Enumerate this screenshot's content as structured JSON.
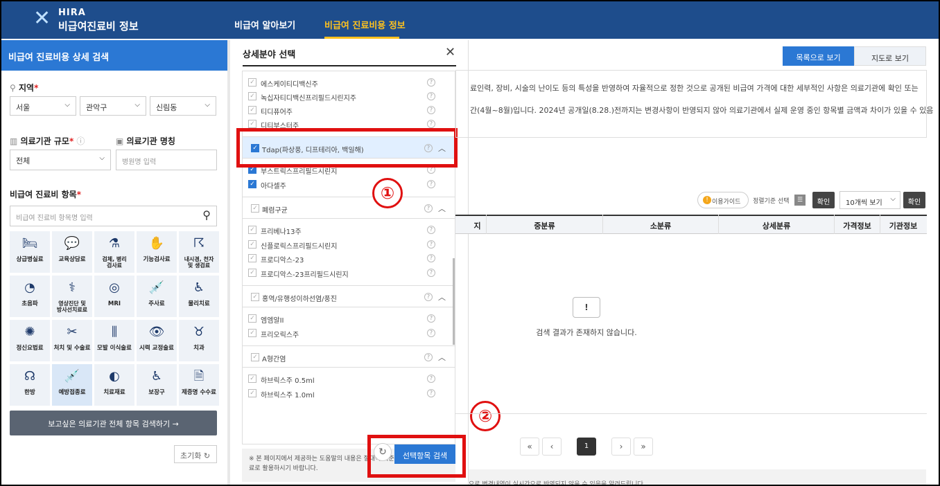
{
  "header": {
    "logo_line1": "HIRA",
    "logo_line2": "비급여진료비 정보",
    "nav": [
      "비급여 알아보기",
      "비급여 진료비용 정보"
    ],
    "accent": "#ffc21e",
    "bg": "#1e4d8c"
  },
  "left": {
    "title": "비급여 진료비용 상세 검색",
    "region_label": "지역",
    "region": [
      "서울",
      "관악구",
      "신림동"
    ],
    "scale_label": "의료기관 규모",
    "scale_value": "전체",
    "name_label": "의료기관 명칭",
    "name_placeholder": "병원명 입력",
    "items_label": "비급여 진료비 항목",
    "items_placeholder": "비급여 진료비 항목명 입력",
    "tiles": [
      "상급병실료",
      "교육상담료",
      "검체, 병리\n검사료",
      "기능검사료",
      "내시경, 천자\n및 생검료",
      "초음파",
      "영상진단 및\n방사선치료료",
      "MRI",
      "주사료",
      "물리치료",
      "정신요법료",
      "처치 및 수술료",
      "모발 이식술료",
      "시력 교정술료",
      "치과",
      "한방",
      "예방접종료",
      "치료재료",
      "보장구",
      "제증명 수수료"
    ],
    "search_all": "보고싶은 의료기관 전체 항목 검색하기 →",
    "reset": "초기화"
  },
  "modal": {
    "title": "상세분야 선택",
    "items_a": [
      "에스케이티디백신주",
      "녹십자티디백신프리필드시린지주",
      "티디퓨어주",
      "디티부스터주"
    ],
    "group_tdap": "Tdap(파상풍, 디프테리아, 백일해)",
    "items_b": [
      "부스트릭스프리필드시린지",
      "아다셀주"
    ],
    "group_pneumo": "폐렴구균",
    "items_c": [
      "프리베나13주",
      "신플로릭스프리필드시린지",
      "프로디악스-23",
      "프로디악스-23프리필드시린지"
    ],
    "group_mmr": "홍역/유행성이하선염/풍진",
    "items_d": [
      "엠엠알II",
      "프리오릭스주"
    ],
    "group_hepa": "A형간염",
    "items_e": [
      "하브릭스주 0.5ml",
      "하브릭스주 1.0ml"
    ],
    "note": "※ 본 페이지에서 제공하는 도움말의 내용은 절대적 기준이 아니오니 참고자료로 활용하시기 바랍니다.",
    "search_btn": "선택항목 검색",
    "marker1": "①",
    "marker2": "②"
  },
  "main": {
    "tab_list": "목록으로 보기",
    "tab_map": "지도로 보기",
    "info1": "료인력, 장비, 시술의 난이도 등의 특성을 반영하여 자율적으로 정한 것으로 공개된 비급여 가격에 대한 세부적인 사항은 의료기관에 확인 또는",
    "info2": "간(4월~8월)입니다. 2024년 공개일(8.28.)전까지는 변경사항이 반영되지 않아 의료기관에서 실제 운영 중인 항목별 금액과 차이가 있을 수 있음",
    "guide": "이용가이드",
    "sort": "정렬기준 선택",
    "confirm": "확인",
    "perpage": "10개씩 보기",
    "columns": [
      "지",
      "중분류",
      "소분류",
      "상세분류",
      "가격정보",
      "기관정보"
    ],
    "empty": "검색 결과가 존재하지 않습니다.",
    "page": "1",
    "footer": "으로 변경내역이 실시간으로 반영되지 않을 수 있음을 알려드립니다."
  }
}
